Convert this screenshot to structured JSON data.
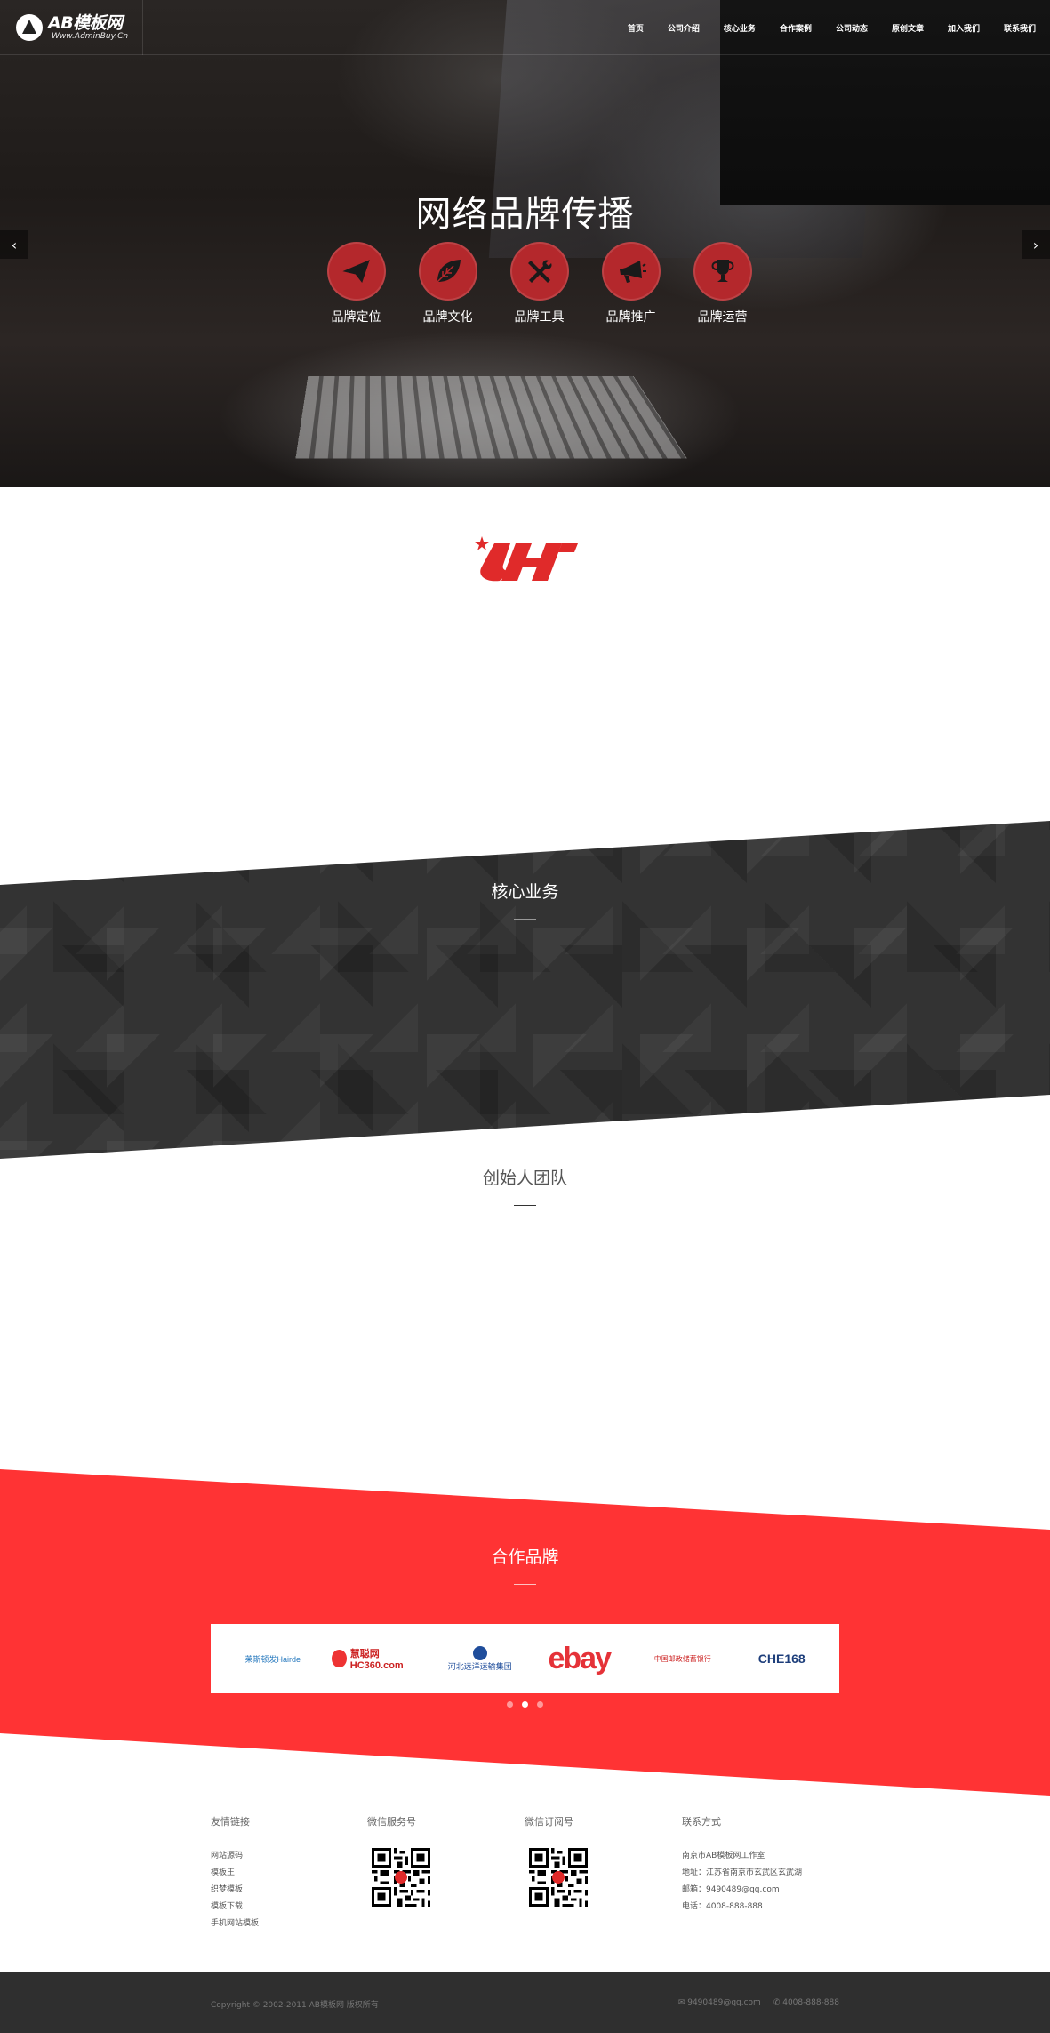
{
  "header": {
    "logo_main": "AB模板网",
    "logo_sub": "Www.AdminBuy.Cn",
    "nav": [
      "首页",
      "公司介绍",
      "核心业务",
      "合作案例",
      "公司动态",
      "原创文章",
      "加入我们",
      "联系我们"
    ]
  },
  "hero": {
    "title": "网络品牌传播",
    "items": [
      {
        "label": "品牌定位",
        "icon": "paper-plane-icon"
      },
      {
        "label": "品牌文化",
        "icon": "leaf-icon"
      },
      {
        "label": "品牌工具",
        "icon": "tools-icon"
      },
      {
        "label": "品牌推广",
        "icon": "megaphone-icon"
      },
      {
        "label": "品牌运营",
        "icon": "trophy-icon"
      }
    ],
    "prev": "‹",
    "next": "›"
  },
  "sections": {
    "core_title": "核心业务",
    "team_title": "创始人团队",
    "partner_title": "合作品牌"
  },
  "partners": [
    "莱斯顿发Hairde",
    "慧聪网 HC360.com",
    "河北远洋运输集团",
    "ebay",
    "中国邮政储蓄银行",
    "CHE168"
  ],
  "footer": {
    "links_title": "友情链接",
    "links": [
      "网站源码",
      "模板王",
      "织梦模板",
      "模板下载",
      "手机网站模板"
    ],
    "wechat_service_title": "微信服务号",
    "wechat_sub_title": "微信订阅号",
    "contact_title": "联系方式",
    "contact_lines": [
      "南京市AB模板网工作室",
      "地址：江苏省南京市玄武区玄武湖",
      "邮箱：9490489@qq.com",
      "电话：4008-888-888"
    ]
  },
  "bottom": {
    "copyright": "Copyright © 2002-2011 AB模板网 版权所有",
    "email": "✉ 9490489@qq.com",
    "phone": "✆ 4008-888-888"
  },
  "colors": {
    "accent_red": "#ff3334",
    "icon_red": "#b4282c",
    "dark_band": "#333333",
    "bottom_bar": "#2f2f2f"
  }
}
